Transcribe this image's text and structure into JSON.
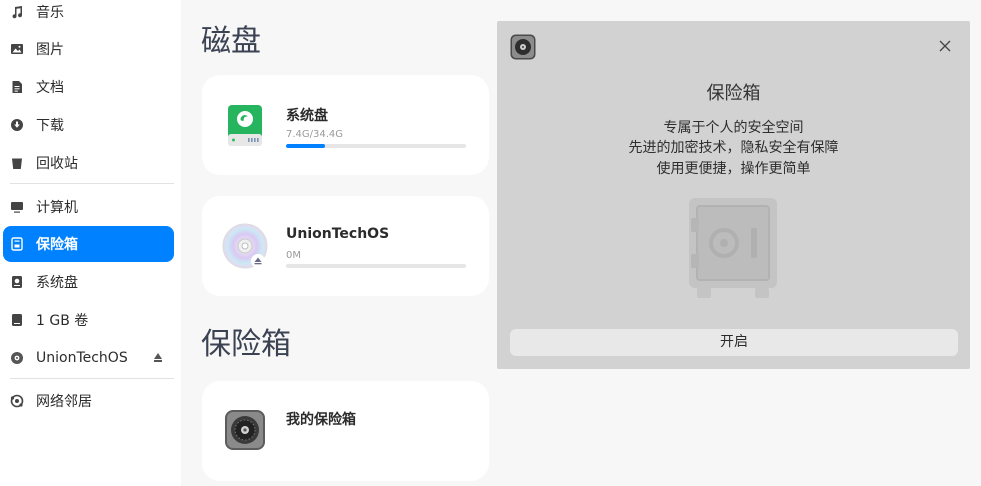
{
  "sidebar": {
    "items": [
      {
        "label": "音乐",
        "icon": "music-icon"
      },
      {
        "label": "图片",
        "icon": "picture-icon"
      },
      {
        "label": "文档",
        "icon": "document-icon"
      },
      {
        "label": "下载",
        "icon": "download-icon"
      },
      {
        "label": "回收站",
        "icon": "trash-icon"
      },
      {
        "label": "计算机",
        "icon": "computer-icon"
      },
      {
        "label": "保险箱",
        "icon": "vault-icon",
        "active": true
      },
      {
        "label": "系统盘",
        "icon": "system-disk-icon"
      },
      {
        "label": "1 GB 卷",
        "icon": "volume-icon"
      },
      {
        "label": "UnionTechOS",
        "icon": "optical-disc-icon",
        "eject": true
      },
      {
        "label": "网络邻居",
        "icon": "network-icon"
      }
    ]
  },
  "main": {
    "disks_title": "磁盘",
    "vault_title": "保险箱",
    "disks": [
      {
        "name": "系统盘",
        "size": "7.4G/34.4G",
        "usage": 0.215,
        "icon": "system-disk-icon"
      },
      {
        "name": "UnionTechOS",
        "size": "0M",
        "usage": 0,
        "icon": "optical-disc-icon"
      }
    ],
    "vault_card": {
      "name": "我的保险箱",
      "icon": "vault-icon"
    }
  },
  "dialog": {
    "title": "保险箱",
    "lines": [
      "专属于个人的安全空间",
      "先进的加密技术，隐私安全有保障",
      "使用更便捷，操作更简单"
    ],
    "button": "开启",
    "icon": "vault-icon",
    "close_icon": "close-icon",
    "illustration": "safe-icon"
  },
  "colors": {
    "accent": "#0081ff",
    "dialog_bg": "#d2d2d2"
  }
}
